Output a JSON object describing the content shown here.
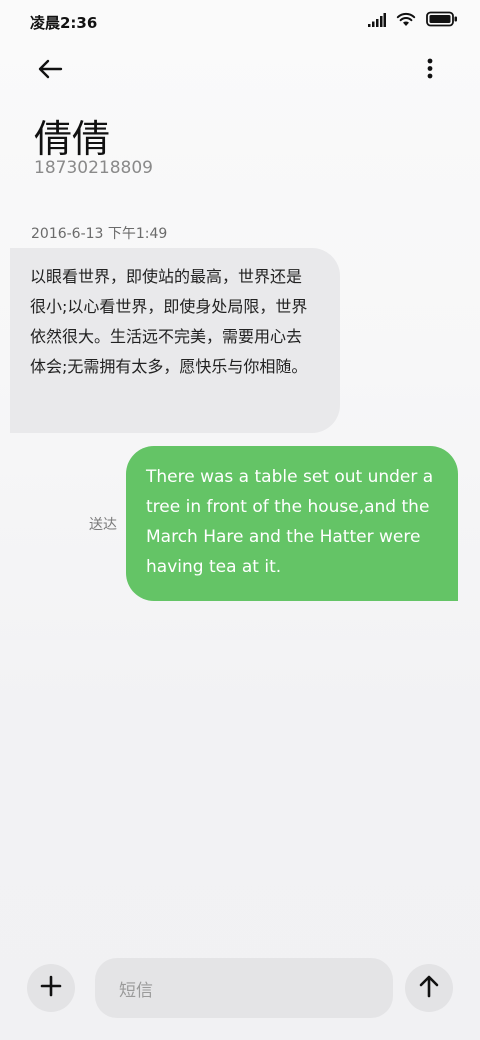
{
  "status_bar": {
    "time": "凌晨2:36",
    "icons": [
      "signal-icon",
      "wifi-icon",
      "battery-icon"
    ]
  },
  "header": {
    "contact_name": "倩倩",
    "contact_number": "18730218809",
    "icons": [
      "back-arrow-icon",
      "more-vertical-icon"
    ]
  },
  "conversation": {
    "timestamp": "2016-6-13 下午1:49",
    "incoming_message": "以眼看世界，即使站的最高，世界还是很小;以心看世界，即使身处局限，世界依然很大。生活远不完美，需要用心去体会;无需拥有太多，愿快乐与你相随。",
    "outgoing_message": "There was a table set out under a tree in front of the house,and the March Hare and the Hatter were having tea at it.",
    "outgoing_status": "送达"
  },
  "compose": {
    "placeholder": "短信",
    "icons": [
      "plus-icon",
      "send-arrow-icon"
    ]
  },
  "colors": {
    "incoming_bubble": "#e9e9eb",
    "outgoing_bubble": "#64c466",
    "background": "#f5f5f6"
  }
}
